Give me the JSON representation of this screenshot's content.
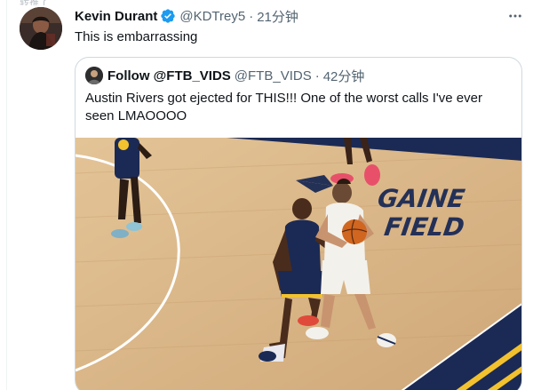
{
  "tweet": {
    "top_remnant": "转推了",
    "author_name": "Kevin Durant",
    "author_handle": "@KDTrey5",
    "separator": "·",
    "timestamp": "21分钟",
    "text": "This is embarrassing",
    "verified_icon": "verified-badge-icon",
    "more_icon": "more-options-icon"
  },
  "quoted_tweet": {
    "author_name": "Follow @FTB_VIDS",
    "author_handle": "@FTB_VIDS",
    "separator": "·",
    "timestamp": "42分钟",
    "text": "Austin Rivers got ejected for THIS!!! One of the worst calls I've ever seen LMAOOOO",
    "media": {
      "court_word_line1": "GAINE",
      "court_word_line2": "FIELD"
    }
  },
  "colors": {
    "text_primary": "#0f1419",
    "text_secondary": "#536471",
    "border": "#cfd9de",
    "verified_blue": "#1d9bf0",
    "court_wood": "#d9b98a",
    "court_navy": "#1b2a55",
    "court_gold": "#f2c12e"
  }
}
